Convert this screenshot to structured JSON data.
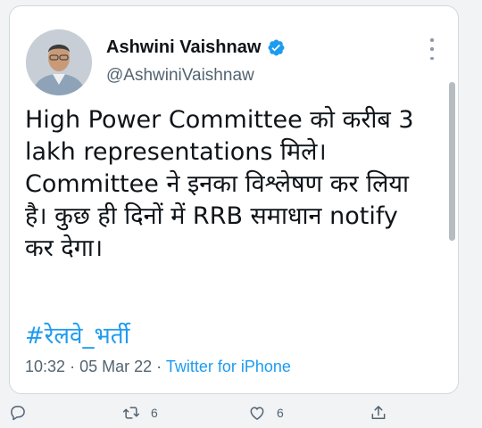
{
  "author": {
    "name": "Ashwini Vaishnaw",
    "handle": "@AshwiniVaishnaw",
    "verified": true,
    "verified_color": "#1d9bf0"
  },
  "tweet": {
    "lines": [
      "High Power Committee को करीब 3",
      "lakh representations मिले।",
      "Committee ने इनका विश्लेषण कर लिया",
      "है। कुछ ही दिनों में RRB समाधान notify",
      "कर देगा।"
    ],
    "hashtag": "#रेलवे_भर्ती"
  },
  "meta": {
    "time": "10:32",
    "date": "05 Mar 22",
    "source": "Twitter for iPhone",
    "separator": "·"
  },
  "actions": {
    "retweets": "6",
    "likes": "6"
  },
  "icons": {
    "reply": "reply-icon",
    "retweet": "retweet-icon",
    "like": "like-icon",
    "share": "share-icon",
    "more": "more-icon"
  },
  "colors": {
    "link": "#1d9bf0",
    "secondary": "#536471",
    "text": "#0f1419"
  }
}
